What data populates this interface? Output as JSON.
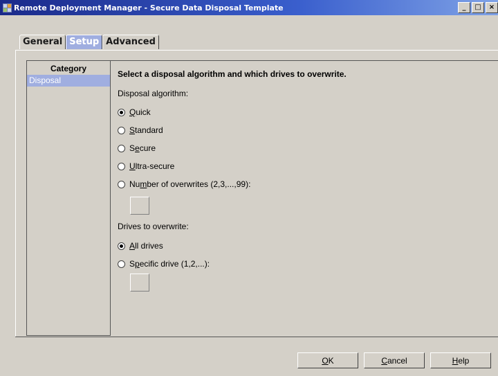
{
  "window": {
    "title": "Remote Deployment Manager - Secure Data Disposal Template",
    "minimize": "_",
    "maximize": "□",
    "close": "×"
  },
  "tabs": [
    {
      "label": "General",
      "active": false
    },
    {
      "label": "Setup",
      "active": true
    },
    {
      "label": "Advanced",
      "active": false
    }
  ],
  "category": {
    "header": "Category",
    "items": [
      {
        "label": "Disposal",
        "selected": true
      }
    ]
  },
  "content": {
    "heading": "Select a disposal algorithm and which drives to overwrite.",
    "algorithm_label": "Disposal algorithm:",
    "algorithms": [
      {
        "pre": "",
        "key": "Q",
        "post": "uick",
        "checked": true
      },
      {
        "pre": "",
        "key": "S",
        "post": "tandard",
        "checked": false
      },
      {
        "pre": "S",
        "key": "e",
        "post": "cure",
        "checked": false
      },
      {
        "pre": "",
        "key": "U",
        "post": "ltra-secure",
        "checked": false
      },
      {
        "pre": "Nu",
        "key": "m",
        "post": "ber of overwrites  (2,3,...,99):",
        "checked": false
      }
    ],
    "overwrites_value": "",
    "drives_label": "Drives to overwrite:",
    "drives": [
      {
        "pre": "",
        "key": "A",
        "post": "ll drives",
        "checked": true
      },
      {
        "pre": "S",
        "key": "p",
        "post": "ecific drive  (1,2,...):",
        "checked": false
      }
    ],
    "drive_value": ""
  },
  "buttons": {
    "ok": {
      "pre": "",
      "key": "O",
      "post": "K"
    },
    "cancel": {
      "pre": "",
      "key": "C",
      "post": "ancel"
    },
    "help": {
      "pre": "",
      "key": "H",
      "post": "elp"
    }
  }
}
